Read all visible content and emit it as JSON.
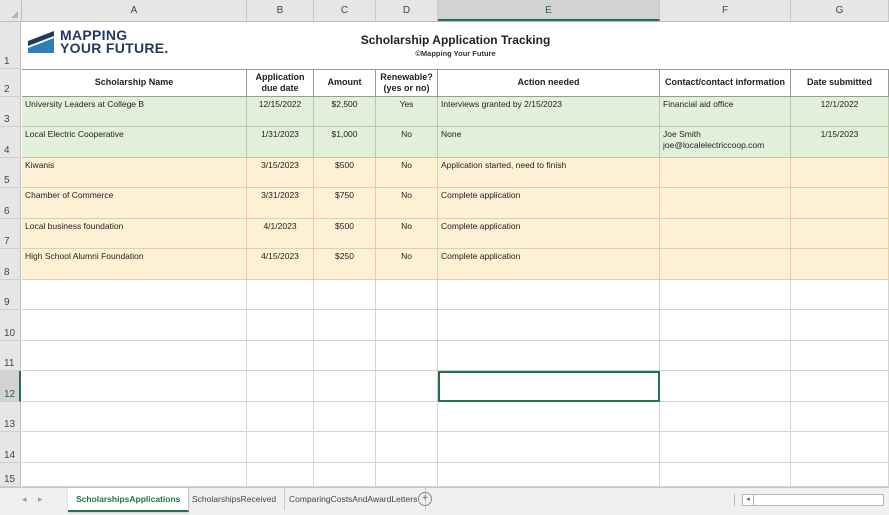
{
  "columns": [
    "A",
    "B",
    "C",
    "D",
    "E",
    "F",
    "G"
  ],
  "selected_column": "E",
  "rows": [
    "1",
    "2",
    "3",
    "4",
    "5",
    "6",
    "7",
    "8",
    "9",
    "10",
    "11",
    "12",
    "13",
    "14",
    "15"
  ],
  "selected_row": "12",
  "logo": {
    "line1": "MAPPING",
    "line2": "YOUR FUTURE.",
    "color": "#1f3a5f"
  },
  "title": "Scholarship Application Tracking",
  "subtitle": "©Mapping Your Future",
  "headers": {
    "name": "Scholarship Name",
    "due_line1": "Application",
    "due_line2": "due date",
    "amount": "Amount",
    "renew_line1": "Renewable?",
    "renew_line2": "(yes or no)",
    "action": "Action needed",
    "contact": "Contact/contact information",
    "submitted": "Date submitted"
  },
  "records": [
    {
      "name": "University Leaders at College B",
      "due": "12/15/2022",
      "amount": "$2,500",
      "renewable": "Yes",
      "action": "Interviews granted by 2/15/2023",
      "contact1": "Financial aid office",
      "contact2": "",
      "submitted": "12/1/2022",
      "status": "green"
    },
    {
      "name": "Local Electric Cooperative",
      "due": "1/31/2023",
      "amount": "$1,000",
      "renewable": "No",
      "action": "None",
      "contact1": "Joe Smith",
      "contact2": "joe@localelectriccoop.com",
      "submitted": "1/15/2023",
      "status": "green"
    },
    {
      "name": "Kiwanis",
      "due": "3/15/2023",
      "amount": "$500",
      "renewable": "No",
      "action": "Application started, need to finish",
      "contact1": "",
      "contact2": "",
      "submitted": "",
      "status": "yellow"
    },
    {
      "name": "Chamber of Commerce",
      "due": "3/31/2023",
      "amount": "$750",
      "renewable": "No",
      "action": "Complete application",
      "contact1": "",
      "contact2": "",
      "submitted": "",
      "status": "yellow"
    },
    {
      "name": "Local business foundation",
      "due": "4/1/2023",
      "amount": "$500",
      "renewable": "No",
      "action": "Complete application",
      "contact1": "",
      "contact2": "",
      "submitted": "",
      "status": "yellow"
    },
    {
      "name": "High School Alumni Foundation",
      "due": "4/15/2023",
      "amount": "$250",
      "renewable": "No",
      "action": "Complete application",
      "contact1": "",
      "contact2": "",
      "submitted": "",
      "status": "yellow"
    }
  ],
  "colors": {
    "applied_green": "#e2efda",
    "pending_yellow": "#fdf0d5",
    "excel_green": "#217346"
  },
  "sheet_tabs": [
    "ScholarshipsApplications",
    "ScholarshipsReceived",
    "ComparingCostsAndAwardLetters"
  ],
  "active_tab": "ScholarshipsApplications"
}
